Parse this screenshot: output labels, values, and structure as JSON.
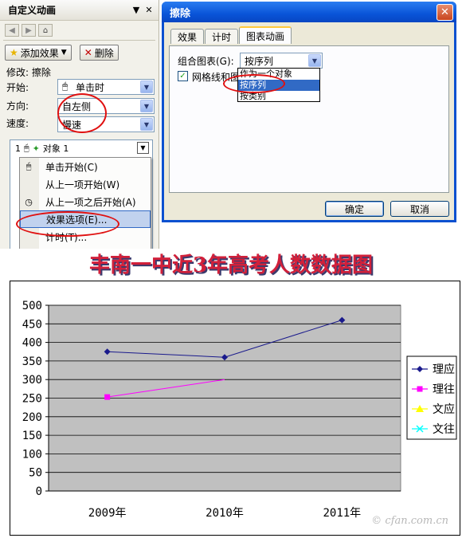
{
  "taskpane": {
    "title": "自定义动画",
    "dropdown_glyph": "▼",
    "close_glyph": "✕",
    "add_effect_label": "添加效果",
    "delete_label": "删除",
    "modify_label": "修改: 擦除",
    "start_label": "开始:",
    "start_value": "单击时",
    "direction_label": "方向:",
    "direction_value": "自左侧",
    "speed_label": "速度:",
    "speed_value": "慢速",
    "list_first_index": "1",
    "list_first_name": "对象 1",
    "context_menu": [
      {
        "label": "单击开始(C)",
        "icon": "mouse-icon"
      },
      {
        "label": "从上一项开始(W)",
        "icon": ""
      },
      {
        "label": "从上一项之后开始(A)",
        "icon": "clock-icon"
      },
      {
        "label": "效果选项(E)...",
        "icon": "",
        "selected": true
      },
      {
        "label": "计时(T)...",
        "icon": ""
      }
    ]
  },
  "dialog": {
    "title": "擦除",
    "tabs": [
      "效果",
      "计时",
      "图表动画"
    ],
    "active_tab": 2,
    "group_label": "组合图表(G):",
    "group_value": "按序列",
    "gridlines_label": "网格线和图",
    "group_options": [
      "作为一个对象",
      "按序列",
      "按类别"
    ],
    "selected_option": 1,
    "ok_label": "确定",
    "cancel_label": "取消"
  },
  "chart_title": "丰南一中近3年高考人数数据图",
  "watermark": "© cfan.com.cn",
  "chart_data": {
    "type": "line",
    "categories": [
      "2009年",
      "2010年",
      "2011年"
    ],
    "yticks": [
      0,
      50,
      100,
      150,
      200,
      250,
      300,
      350,
      400,
      450,
      500
    ],
    "ylim": [
      0,
      500
    ],
    "grid": true,
    "plot_background": "#c0c0c0",
    "legend_position": "right",
    "series": [
      {
        "name": "理应",
        "values": [
          375,
          360,
          460
        ],
        "color": "#1a1a8c",
        "marker": "diamond"
      },
      {
        "name": "理往",
        "values": [
          253,
          300,
          null
        ],
        "color": "#ff00ff",
        "marker": "square"
      },
      {
        "name": "文应",
        "values": [
          null,
          null,
          null
        ],
        "color": "#ffff00",
        "marker": "triangle"
      },
      {
        "name": "文往",
        "values": [
          null,
          null,
          null
        ],
        "color": "#00ffff",
        "marker": "x"
      }
    ]
  }
}
